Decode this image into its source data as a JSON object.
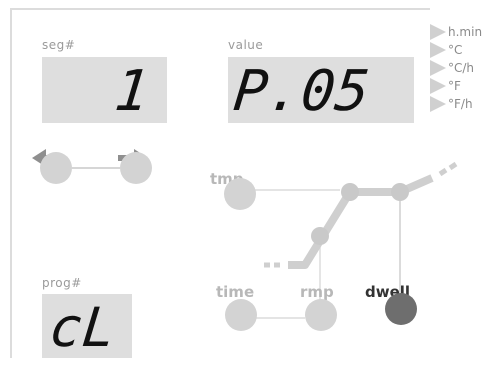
{
  "segment": {
    "label": "seg#",
    "value": "1"
  },
  "value": {
    "label": "value",
    "value": "P.05"
  },
  "program": {
    "label": "prog#",
    "value": "cL"
  },
  "units": [
    "h.min",
    "°C",
    "°C/h",
    "°F",
    "°F/h"
  ],
  "diagram": {
    "tmp_label": "tmp",
    "time_label": "time",
    "rmp_label": "rmp",
    "dwell_label": "dwell"
  },
  "colors": {
    "display_bg": "#dedede",
    "inactive": "#d3d3d3",
    "active": "#6e6e6e"
  }
}
